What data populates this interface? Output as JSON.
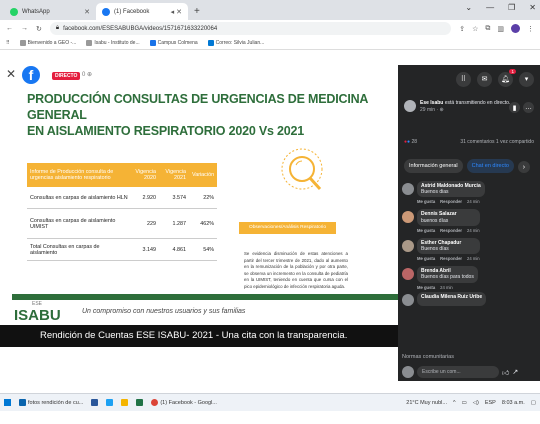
{
  "browser": {
    "tabs": [
      {
        "label": "WhatsApp",
        "favicon_color": "#25d366",
        "active": false
      },
      {
        "label": "(1) Facebook",
        "favicon_color": "#1877f2",
        "active": true
      }
    ],
    "url": "facebook.com/ESESABUBGA/videos/1571671633220064",
    "bookmarks": [
      "Bienvenido a GEO -...",
      "Isabu - Instituto de...",
      "Campus Colmena",
      "Correo: Silvia Julian..."
    ]
  },
  "video": {
    "live_label": "DIRECTO",
    "viewers": "0 ⊕",
    "slide_title_line1": "PRODUCCIÓN CONSULTAS DE URGENCIAS DE MEDICINA GENERAL",
    "slide_title_line2": "EN AISLAMIENTO RESPIRATORIO 2020 Vs 2021",
    "table": {
      "headers": [
        "Informe de Producción consulta de urgencias aislamiento respiratorio",
        "Vigencia 2020",
        "Vigencia 2021",
        "Variación"
      ],
      "rows": [
        [
          "Consultas en carpas de aislamiento HLN",
          "2.920",
          "3.574",
          "22%"
        ],
        [
          "Consultas en carpas de aislamiento UIMIST",
          "229",
          "1.287",
          "462%"
        ],
        [
          "Total Consultas en carpas de aislamiento",
          "3.149",
          "4.861",
          "54%"
        ]
      ]
    },
    "observations_label": "Observaciones/Análisis Respiratorio",
    "observations_text": "Se evidencia disminución de estas atenciones a partir del tercer trimestre de 2021, dado al aumento en la remunización de la población y por otra parte, se observa un incremento en la consulta de pediatría en la UIMIST, teniendo en cuenta que cursa con el pico epidemiológico de infección respiratoria aguda.",
    "brand_small": "ESE",
    "brand": "ISABU",
    "tagline": "Un compromiso con nuestros usuarios y sus familias",
    "caption": "Rendición de Cuentas ESE ISABU- 2021 - Una cita con la transparencia."
  },
  "panel": {
    "host_name": "Ese Isabu",
    "host_action": " está transmitiendo en directo.",
    "host_time": "29 min · ⊕",
    "reaction_count": "28",
    "stats": "31 comentarios  1 vez compartido",
    "tab_info": "Información general",
    "tab_chat": "Chat en directo",
    "comments": [
      {
        "name": "Astrid Maldonado Murcia",
        "text": "Buenos dias",
        "time": "24 min"
      },
      {
        "name": "Dennis Salazar",
        "text": "buenos días",
        "time": "24 min"
      },
      {
        "name": "Esther Chapadur",
        "text": "Buenos días",
        "time": "24 min"
      },
      {
        "name": "Brenda Abril",
        "text": "Buenos días para todos",
        "time": "24 min"
      }
    ],
    "like_label": "Me gusta",
    "reply_label": "Responder",
    "partial_commenter": "Claudia Milena Ruiz Uribe",
    "normas": "Normas comunitarias",
    "composer_placeholder": "Escribe un com..."
  },
  "taskbar": {
    "apps": [
      "fotos rendición de cu...",
      "(1) Facebook - Googl..."
    ],
    "weather": "21°C  Muy nubl...",
    "lang": "ESP",
    "clock": "8:03 a.m."
  }
}
